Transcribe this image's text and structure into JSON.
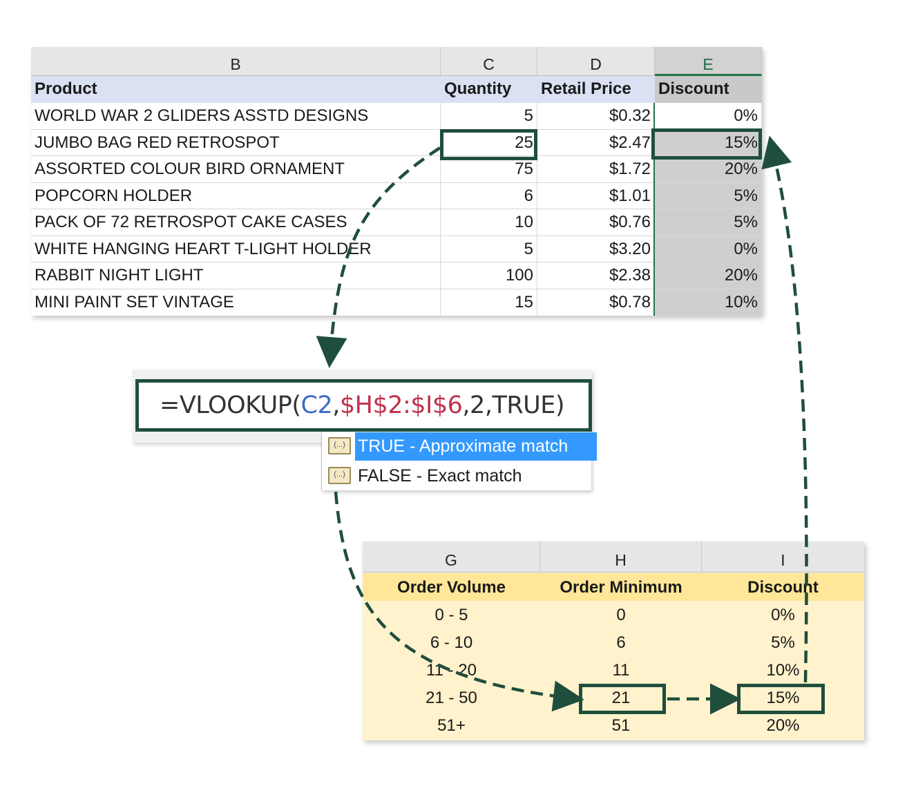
{
  "sheet": {
    "columns": [
      "B",
      "C",
      "D",
      "E"
    ],
    "header": {
      "product": "Product",
      "quantity": "Quantity",
      "retail_price": "Retail Price",
      "discount": "Discount"
    },
    "rows": [
      {
        "product": "WORLD WAR 2 GLIDERS ASSTD DESIGNS",
        "quantity": "5",
        "price": "$0.32",
        "discount": "0%"
      },
      {
        "product": "JUMBO BAG RED RETROSPOT",
        "quantity": "25",
        "price": "$2.47",
        "discount": "15%"
      },
      {
        "product": "ASSORTED COLOUR BIRD ORNAMENT",
        "quantity": "75",
        "price": "$1.72",
        "discount": "20%"
      },
      {
        "product": "POPCORN HOLDER",
        "quantity": "6",
        "price": "$1.01",
        "discount": "5%"
      },
      {
        "product": "PACK OF 72 RETROSPOT CAKE CASES",
        "quantity": "10",
        "price": "$0.76",
        "discount": "5%"
      },
      {
        "product": "WHITE HANGING HEART T-LIGHT HOLDER",
        "quantity": "5",
        "price": "$3.20",
        "discount": "0%"
      },
      {
        "product": "RABBIT NIGHT LIGHT",
        "quantity": "100",
        "price": "$2.38",
        "discount": "20%"
      },
      {
        "product": "MINI PAINT SET VINTAGE",
        "quantity": "15",
        "price": "$0.78",
        "discount": "10%"
      }
    ]
  },
  "formula": {
    "parts": [
      "=VLOOKUP(",
      "C2",
      ",",
      "$H$2:$I$6",
      ",2,TRUE)"
    ]
  },
  "autocomplete": {
    "items": [
      {
        "label": "TRUE - Approximate match",
        "icon": "function-argument-icon"
      },
      {
        "label": "FALSE - Exact match",
        "icon": "function-argument-icon"
      }
    ]
  },
  "lookup": {
    "columns": [
      "G",
      "H",
      "I"
    ],
    "header": {
      "order_volume": "Order Volume",
      "order_minimum": "Order Minimum",
      "discount": "Discount"
    },
    "rows": [
      {
        "volume": "0 - 5",
        "minimum": "0",
        "discount": "0%"
      },
      {
        "volume": "6 - 10",
        "minimum": "6",
        "discount": "5%"
      },
      {
        "volume": "11 - 20",
        "minimum": "11",
        "discount": "10%"
      },
      {
        "volume": "21 - 50",
        "minimum": "21",
        "discount": "15%"
      },
      {
        "volume": "51+",
        "minimum": "51",
        "discount": "20%"
      }
    ]
  },
  "colors": {
    "highlight_border": "#1f4e3d",
    "sheet_header_fill": "#d9e1f2",
    "lookup_fill": "#fff2cc",
    "lookup_header_fill": "#ffe699",
    "ref_blue": "#3a6cc8",
    "ref_red": "#c0304a",
    "selection_blue": "#3399ff"
  }
}
